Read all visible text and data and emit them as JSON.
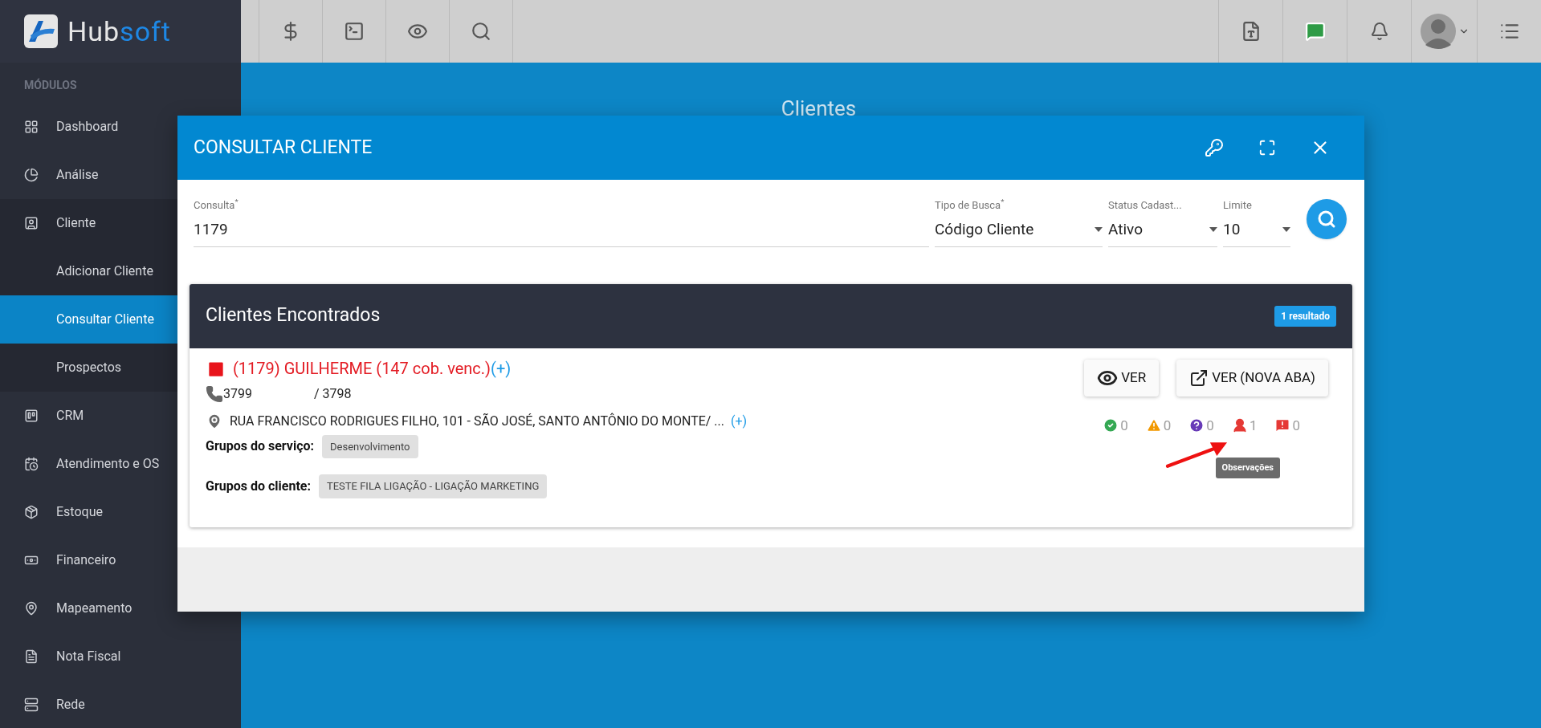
{
  "top_bar": {
    "logo_text": [
      "Hub",
      "soft"
    ]
  },
  "page": {
    "title": "Clientes"
  },
  "sidebar": {
    "heading": "MÓDULOS",
    "items": [
      {
        "label": "Dashboard",
        "selected": false
      },
      {
        "label": "Análise",
        "selected": false
      },
      {
        "label": "Cliente",
        "selected": false,
        "children": [
          {
            "label": "Adicionar Cliente",
            "selected": false
          },
          {
            "label": "Consultar Cliente",
            "selected": true
          },
          {
            "label": "Prospectos",
            "selected": false
          }
        ]
      },
      {
        "label": "CRM",
        "selected": false
      },
      {
        "label": "Atendimento e OS",
        "selected": false
      },
      {
        "label": "Estoque",
        "selected": false
      },
      {
        "label": "Financeiro",
        "selected": false
      },
      {
        "label": "Mapeamento",
        "selected": false
      },
      {
        "label": "Nota Fiscal",
        "selected": false
      },
      {
        "label": "Rede",
        "selected": false
      }
    ]
  },
  "modal": {
    "title": "CONSULTAR CLIENTE",
    "fields": [
      {
        "label": "Consulta$^{*}$",
        "value": "1179",
        "kind": "text"
      },
      {
        "label": "Tipo de Busca$^{*}$",
        "value": "Código Cliente",
        "kind": "select"
      },
      {
        "label": "Status Cadast...",
        "value": "Ativo",
        "kind": "select"
      },
      {
        "label": "Limite",
        "value": "10",
        "kind": "select"
      }
    ],
    "results": {
      "title": "Clientes Encontrados",
      "badge": "1 resultado",
      "client": {
        "name": "(1179) GUILHERME (147 cob. venc.)",
        "name_more": "(+)",
        "phone_1": "3799",
        "phone_2": "/ 3798",
        "address": "RUA FRANCISCO RODRIGUES FILHO, 101 - SÃO JOSÉ, SANTO ANTÔNIO DO MONTE/ ...",
        "address_more": "(+)",
        "groups": [
          {
            "label": "Grupos do serviço:",
            "tags": [
              "Desenvolvimento"
            ]
          },
          {
            "label": "Grupos do cliente:",
            "tags": [
              "TESTE FILA LIGAÇÃO - LIGAÇÃO MARKETING"
            ]
          }
        ],
        "buttons": [
          {
            "label": "VER",
            "kind": "view"
          },
          {
            "label": "VER (NOVA ABA)",
            "kind": "open"
          }
        ],
        "counters": [
          {
            "kind": "done",
            "count": "0"
          },
          {
            "kind": "warning",
            "count": "0"
          },
          {
            "kind": "question",
            "count": "0"
          },
          {
            "kind": "person",
            "count": "1"
          },
          {
            "kind": "alert",
            "count": "0"
          }
        ],
        "tooltip": "Observações"
      }
    }
  }
}
